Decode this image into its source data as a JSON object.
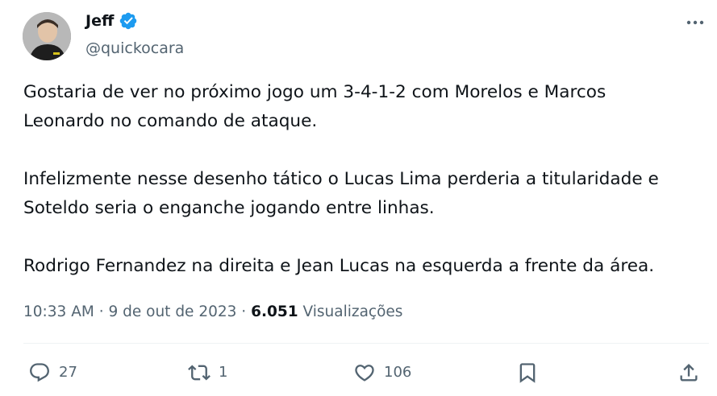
{
  "author": {
    "name": "Jeff",
    "handle": "@quickocara",
    "verified_color": "#1d9bf0"
  },
  "tweet": {
    "text": "Gostaria de ver no próximo jogo um 3-4-1-2 com Morelos e Marcos\nLeonardo no comando de ataque.\n\nInfelizmente nesse desenho tático o Lucas Lima perderia a titularidade e\nSoteldo seria o enganche jogando entre linhas.\n\nRodrigo Fernandez na direita e Jean Lucas na esquerda a frente da área.",
    "time": "10:33 AM",
    "separator": "·",
    "date": "9 de out de 2023",
    "views_count": "6.051",
    "views_label": "Visualizações"
  },
  "actions": {
    "reply_count": "27",
    "retweet_count": "1",
    "like_count": "106"
  },
  "icons": {
    "more": "more-horizontal-icon",
    "verified": "verified-badge-icon",
    "reply": "reply-icon",
    "retweet": "retweet-icon",
    "like": "heart-icon",
    "bookmark": "bookmark-icon",
    "share": "share-icon"
  },
  "colors": {
    "text": "#0f1419",
    "secondary": "#536471",
    "divider": "#eff3f4"
  }
}
